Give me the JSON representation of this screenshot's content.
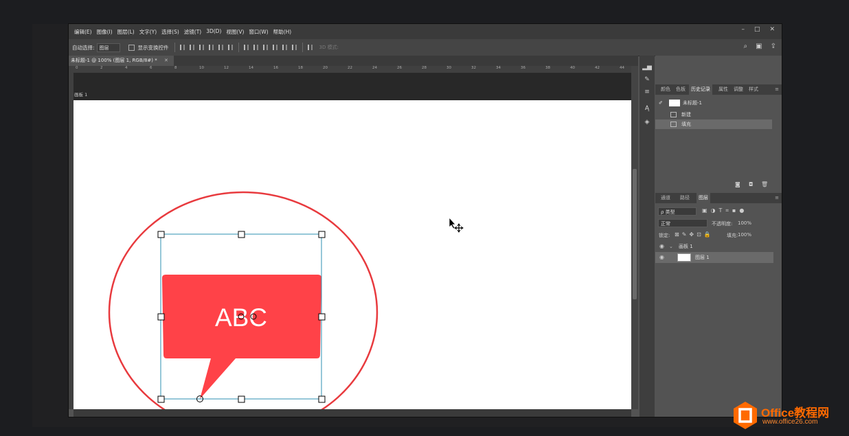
{
  "menu": {
    "items": [
      "编辑(E)",
      "图像(I)",
      "图层(L)",
      "文字(Y)",
      "选择(S)",
      "滤镜(T)",
      "3D(D)",
      "视图(V)",
      "窗口(W)",
      "帮助(H)"
    ],
    "min": "–",
    "max": "□",
    "close": "✕"
  },
  "options": {
    "auto_select_label": "自动选择:",
    "auto_select_value": "图层",
    "show_transform_label": "显示变换控件",
    "mode_3d_label": "3D 模式:"
  },
  "document": {
    "tab_title": "未标题-1 @ 100% (图层 1, RGB/8#) *",
    "close": "✕",
    "artboard_label": "画板 1",
    "ruler_ticks": [
      "0",
      "2",
      "4",
      "6",
      "8",
      "10",
      "12",
      "14",
      "16",
      "18",
      "20",
      "22",
      "24",
      "26",
      "28",
      "30",
      "32",
      "34",
      "36",
      "38",
      "40",
      "42",
      "44"
    ]
  },
  "canvas": {
    "bubble_text": "ABC",
    "bubble_color": "#ff4248",
    "circle_color": "#e83a3e",
    "selection_color": "#2b8fb0"
  },
  "history_panel": {
    "tabs": [
      "颜色",
      "色板",
      "历史记录",
      "属性",
      "调整",
      "样式"
    ],
    "active_tab": "历史记录",
    "snapshot": "未标题-1",
    "rows": [
      "新建",
      "填充"
    ]
  },
  "layers_panel": {
    "tabs": [
      "通道",
      "路径",
      "图层"
    ],
    "active_tab": "图层",
    "filter_label": "ρ 类型",
    "blend_mode": "正常",
    "opacity_label": "不透明度:",
    "opacity_value": "100%",
    "lock_label": "锁定:",
    "fill_label": "填充:",
    "fill_value": "100%",
    "layers": [
      "画板 1",
      "图层 1"
    ]
  },
  "watermark": {
    "brand": "Office教程网",
    "url": "www.office26.com",
    "color": "#ff6a00"
  }
}
